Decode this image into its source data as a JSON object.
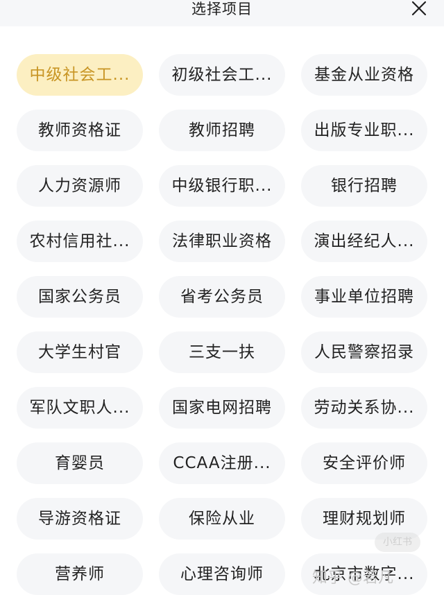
{
  "header": {
    "title": "选择项目",
    "close_icon": "close-icon"
  },
  "selected_index": 0,
  "colors": {
    "selected_bg": "#fcefc2",
    "selected_text": "#c89524",
    "chip_bg": "#f5f6f8",
    "chip_text": "#222222"
  },
  "items": [
    {
      "label": "中级社会工..."
    },
    {
      "label": "初级社会工..."
    },
    {
      "label": "基金从业资格"
    },
    {
      "label": "教师资格证"
    },
    {
      "label": "教师招聘"
    },
    {
      "label": "出版专业职..."
    },
    {
      "label": "人力资源师"
    },
    {
      "label": "中级银行职..."
    },
    {
      "label": "银行招聘"
    },
    {
      "label": "农村信用社..."
    },
    {
      "label": "法律职业资格"
    },
    {
      "label": "演出经纪人..."
    },
    {
      "label": "国家公务员"
    },
    {
      "label": "省考公务员"
    },
    {
      "label": "事业单位招聘"
    },
    {
      "label": "大学生村官"
    },
    {
      "label": "三支一扶"
    },
    {
      "label": "人民警察招录"
    },
    {
      "label": "军队文职人..."
    },
    {
      "label": "国家电网招聘"
    },
    {
      "label": "劳动关系协..."
    },
    {
      "label": "育婴员"
    },
    {
      "label": "CCAA注册..."
    },
    {
      "label": "安全评价师"
    },
    {
      "label": "导游资格证"
    },
    {
      "label": "保险从业"
    },
    {
      "label": "理财规划师"
    },
    {
      "label": "营养师"
    },
    {
      "label": "心理咨询师"
    },
    {
      "label": "北京市数字..."
    }
  ],
  "watermark": {
    "text": "知乎 @若凡",
    "badge": "小红书"
  }
}
